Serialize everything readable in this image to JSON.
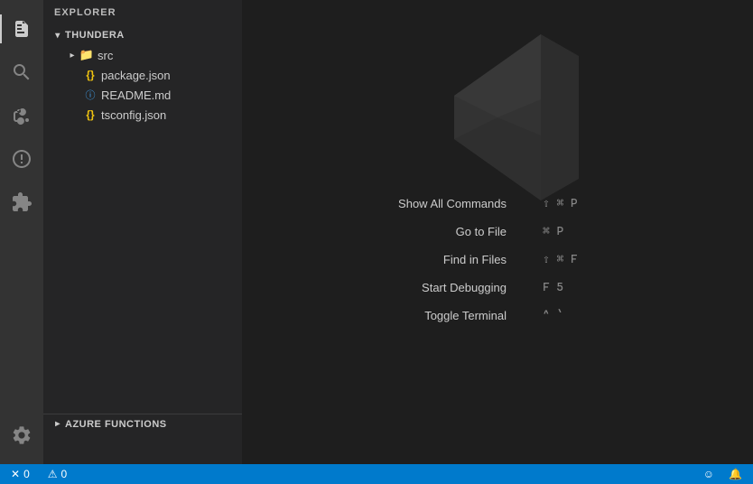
{
  "activityBar": {
    "icons": [
      {
        "name": "files-icon",
        "symbol": "⎘",
        "active": true
      },
      {
        "name": "search-icon",
        "symbol": "🔍",
        "active": false
      },
      {
        "name": "source-control-icon",
        "symbol": "⑂",
        "active": false
      },
      {
        "name": "debug-icon",
        "symbol": "⊘",
        "active": false
      },
      {
        "name": "extensions-icon",
        "symbol": "⊞",
        "active": false
      }
    ],
    "bottomIcons": [
      {
        "name": "settings-icon",
        "symbol": "⚙",
        "active": false
      }
    ]
  },
  "sidebar": {
    "header": "Explorer",
    "tree": {
      "rootName": "THUNDERA",
      "items": [
        {
          "type": "folder",
          "name": "src",
          "indent": 1
        },
        {
          "type": "json",
          "name": "package.json",
          "indent": 2
        },
        {
          "type": "md",
          "name": "README.md",
          "indent": 2
        },
        {
          "type": "json",
          "name": "tsconfig.json",
          "indent": 2
        }
      ]
    },
    "azureSection": "AZURE FUNCTIONS"
  },
  "commands": [
    {
      "label": "Show All Commands",
      "shortcut": "⇧ ⌘ P"
    },
    {
      "label": "Go to File",
      "shortcut": "⌘ P"
    },
    {
      "label": "Find in Files",
      "shortcut": "⇧ ⌘ F"
    },
    {
      "label": "Start Debugging",
      "shortcut": "F 5"
    },
    {
      "label": "Toggle Terminal",
      "shortcut": "^ `"
    }
  ],
  "statusBar": {
    "errors": "0",
    "warnings": "0",
    "smileySymbol": "☺",
    "bellSymbol": "🔔"
  }
}
